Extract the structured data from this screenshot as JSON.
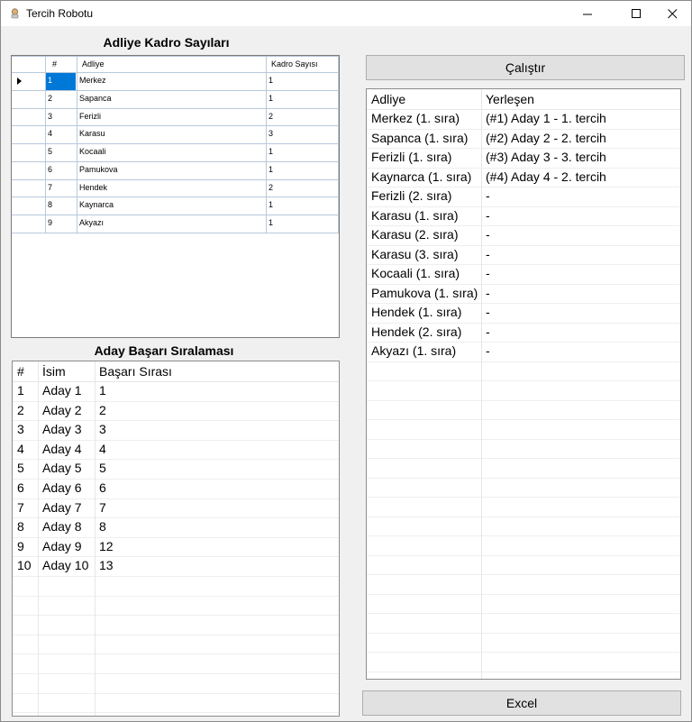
{
  "window": {
    "title": "Tercih Robotu"
  },
  "adliye_section": {
    "title": "Adliye Kadro Sayıları",
    "columns": [
      "#",
      "Adliye",
      "Kadro Sayısı"
    ],
    "rows": [
      {
        "no": "1",
        "adliye": "Merkez",
        "kadro": "1"
      },
      {
        "no": "2",
        "adliye": "Sapanca",
        "kadro": "1"
      },
      {
        "no": "3",
        "adliye": "Ferizli",
        "kadro": "2"
      },
      {
        "no": "4",
        "adliye": "Karasu",
        "kadro": "3"
      },
      {
        "no": "5",
        "adliye": "Kocaali",
        "kadro": "1"
      },
      {
        "no": "6",
        "adliye": "Pamukova",
        "kadro": "1"
      },
      {
        "no": "7",
        "adliye": "Hendek",
        "kadro": "2"
      },
      {
        "no": "8",
        "adliye": "Kaynarca",
        "kadro": "1"
      },
      {
        "no": "9",
        "adliye": "Akyazı",
        "kadro": "1"
      }
    ]
  },
  "aday_section": {
    "title": "Aday Başarı Sıralaması",
    "columns": [
      "#",
      "İsim",
      "Başarı Sırası"
    ],
    "rows": [
      {
        "no": "1",
        "isim": "Aday 1",
        "sira": "1"
      },
      {
        "no": "2",
        "isim": "Aday 2",
        "sira": "2"
      },
      {
        "no": "3",
        "isim": "Aday 3",
        "sira": "3"
      },
      {
        "no": "4",
        "isim": "Aday 4",
        "sira": "4"
      },
      {
        "no": "5",
        "isim": "Aday 5",
        "sira": "5"
      },
      {
        "no": "6",
        "isim": "Aday 6",
        "sira": "6"
      },
      {
        "no": "7",
        "isim": "Aday 7",
        "sira": "7"
      },
      {
        "no": "8",
        "isim": "Aday 8",
        "sira": "8"
      },
      {
        "no": "9",
        "isim": "Aday 9",
        "sira": "12"
      },
      {
        "no": "10",
        "isim": "Aday 10",
        "sira": "13"
      }
    ]
  },
  "results": {
    "columns": [
      "Adliye",
      "Yerleşen"
    ],
    "rows": [
      {
        "adliye": "Merkez (1. sıra)",
        "yerlesen": "(#1) Aday 1 - 1. tercih"
      },
      {
        "adliye": "Sapanca (1. sıra)",
        "yerlesen": "(#2) Aday 2 - 2. tercih"
      },
      {
        "adliye": "Ferizli (1. sıra)",
        "yerlesen": "(#3) Aday 3 - 3. tercih"
      },
      {
        "adliye": "Kaynarca (1. sıra)",
        "yerlesen": "(#4) Aday 4 - 2. tercih"
      },
      {
        "adliye": "Ferizli (2. sıra)",
        "yerlesen": "-"
      },
      {
        "adliye": "Karasu (1. sıra)",
        "yerlesen": "-"
      },
      {
        "adliye": "Karasu (2. sıra)",
        "yerlesen": "-"
      },
      {
        "adliye": "Karasu (3. sıra)",
        "yerlesen": "-"
      },
      {
        "adliye": "Kocaali (1. sıra)",
        "yerlesen": "-"
      },
      {
        "adliye": "Pamukova (1. sıra)",
        "yerlesen": "-"
      },
      {
        "adliye": "Hendek (1. sıra)",
        "yerlesen": "-"
      },
      {
        "adliye": "Hendek (2. sıra)",
        "yerlesen": "-"
      },
      {
        "adliye": "Akyazı (1. sıra)",
        "yerlesen": "-"
      }
    ]
  },
  "buttons": {
    "run": "Çalıştır",
    "excel": "Excel"
  },
  "colors": {
    "selection": "#0078d7",
    "grid_line": "#b8c8dc"
  },
  "icons": {
    "app": "app-icon",
    "row_pointer": "row-pointer-icon"
  }
}
